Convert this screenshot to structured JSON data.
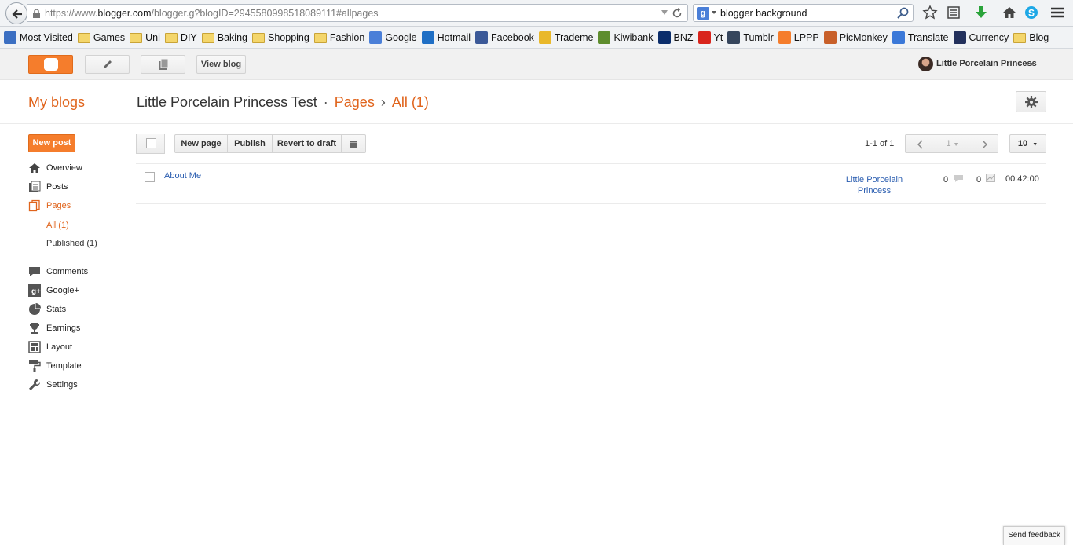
{
  "browser": {
    "url_prefix": "https://www.",
    "url_domain": "blogger.com",
    "url_rest": "/blogger.g?blogID=2945580998518089111#allpages",
    "search_value": "blogger background"
  },
  "bookmarks": [
    {
      "label": "Most Visited",
      "icon": "most-visited-icon",
      "color": "#3b6fc2"
    },
    {
      "label": "Games",
      "icon": "folder-icon",
      "color": "#f4d66b"
    },
    {
      "label": "Uni",
      "icon": "folder-icon",
      "color": "#f4d66b"
    },
    {
      "label": "DIY",
      "icon": "folder-icon",
      "color": "#f4d66b"
    },
    {
      "label": "Baking",
      "icon": "folder-icon",
      "color": "#f4d66b"
    },
    {
      "label": "Shopping",
      "icon": "folder-icon",
      "color": "#f4d66b"
    },
    {
      "label": "Fashion",
      "icon": "folder-icon",
      "color": "#f4d66b"
    },
    {
      "label": "Google",
      "icon": "google-icon",
      "color": "#4a7fd8"
    },
    {
      "label": "Hotmail",
      "icon": "outlook-icon",
      "color": "#1f6fc5"
    },
    {
      "label": "Facebook",
      "icon": "facebook-icon",
      "color": "#3b5998"
    },
    {
      "label": "Trademe",
      "icon": "trademe-icon",
      "color": "#e9b82a"
    },
    {
      "label": "Kiwibank",
      "icon": "kiwibank-icon",
      "color": "#5e8d2e"
    },
    {
      "label": "BNZ",
      "icon": "bnz-icon",
      "color": "#0b2d6b"
    },
    {
      "label": "Yt",
      "icon": "youtube-icon",
      "color": "#d9251d"
    },
    {
      "label": "Tumblr",
      "icon": "tumblr-icon",
      "color": "#36465d"
    },
    {
      "label": "LPPP",
      "icon": "blogger-icon",
      "color": "#f57d2c"
    },
    {
      "label": "PicMonkey",
      "icon": "picmonkey-icon",
      "color": "#c8602a"
    },
    {
      "label": "Translate",
      "icon": "translate-icon",
      "color": "#3a78d8"
    },
    {
      "label": "Currency",
      "icon": "xe-icon",
      "color": "#22305c"
    },
    {
      "label": "Blog",
      "icon": "folder-icon",
      "color": "#f4d66b"
    }
  ],
  "header": {
    "view_blog": "View blog",
    "user_name": "Little Porcelain Princess"
  },
  "title": {
    "my_blogs": "My blogs",
    "blog_name": "Little Porcelain Princess Test",
    "dot": "·",
    "section": "Pages",
    "arrow": "›",
    "filter": "All (1)"
  },
  "sidebar": {
    "new_post": "New post",
    "items": [
      {
        "label": "Overview",
        "icon": "home-icon"
      },
      {
        "label": "Posts",
        "icon": "posts-icon"
      },
      {
        "label": "Pages",
        "icon": "pages-icon"
      },
      {
        "label": "Comments",
        "icon": "comments-icon"
      },
      {
        "label": "Google+",
        "icon": "google-plus-icon"
      },
      {
        "label": "Stats",
        "icon": "stats-icon"
      },
      {
        "label": "Earnings",
        "icon": "trophy-icon"
      },
      {
        "label": "Layout",
        "icon": "layout-icon"
      },
      {
        "label": "Template",
        "icon": "paint-roller-icon"
      },
      {
        "label": "Settings",
        "icon": "wrench-icon"
      }
    ],
    "sub_all": "All (1)",
    "sub_published": "Published (1)"
  },
  "toolbar": {
    "new_page": "New page",
    "publish": "Publish",
    "revert": "Revert to draft",
    "pager": "1-1 of 1",
    "page_num": "1",
    "per_page": "10"
  },
  "pages": [
    {
      "title": "About Me",
      "author": "Little Porcelain Princess",
      "comments": "0",
      "views": "0",
      "time": "00:42:00"
    }
  ],
  "feedback": "Send feedback",
  "colors": {
    "accent": "#f57d2c",
    "link": "#2a5db0",
    "active": "#e0641c"
  }
}
